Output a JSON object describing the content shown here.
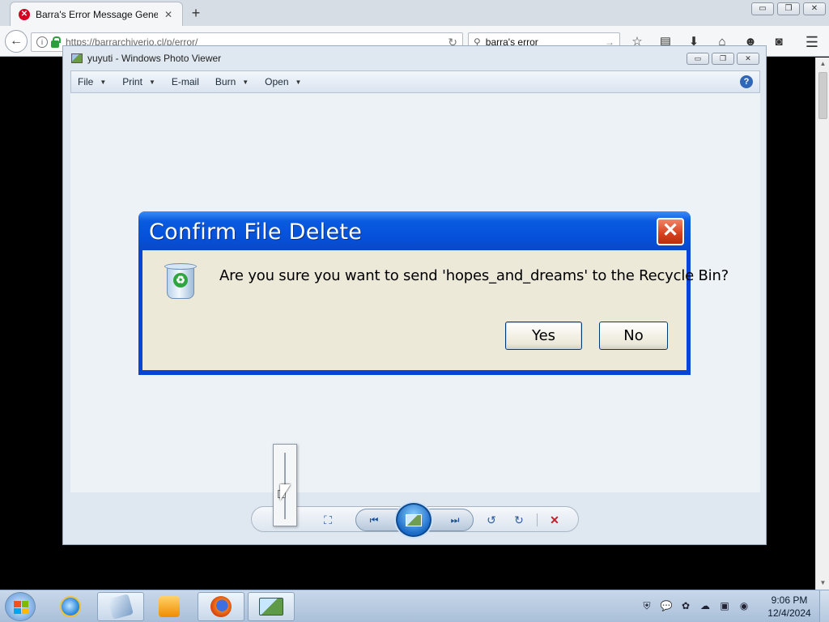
{
  "browser": {
    "tab_title": "Barra's Error Message Gene...",
    "tab_close": "✕",
    "new_tab": "+",
    "url": "https://barrarchiverio.cl/p/error/",
    "search_query": "barra's error",
    "win_buttons": [
      "▭",
      "❐",
      "✕"
    ],
    "toolbar_icons": [
      "bookmark-star-icon",
      "library-icon",
      "download-icon",
      "home-icon",
      "emoji-icon",
      "pocket-icon"
    ]
  },
  "photo_viewer": {
    "title": "yuyuti - Windows Photo Viewer",
    "win_buttons": [
      "▭",
      "❐",
      "✕"
    ],
    "menu": [
      {
        "label": "File",
        "caret": true
      },
      {
        "label": "Print",
        "caret": true
      },
      {
        "label": "E-mail",
        "caret": false
      },
      {
        "label": "Burn",
        "caret": true
      },
      {
        "label": "Open",
        "caret": true
      }
    ],
    "help": "?"
  },
  "dialog": {
    "title": "Confirm File Delete",
    "close": "✕",
    "message": "Are you sure you want to send 'hopes_and_dreams' to the Recycle Bin?",
    "yes_label": "Yes",
    "no_label": "No"
  },
  "taskbar": {
    "clock_time": "9:06 PM",
    "clock_date": "12/4/2024"
  },
  "colors": {
    "dialog_title": "#0550d9",
    "dialog_body": "#ece9d8",
    "close_button": "#d6401d"
  }
}
